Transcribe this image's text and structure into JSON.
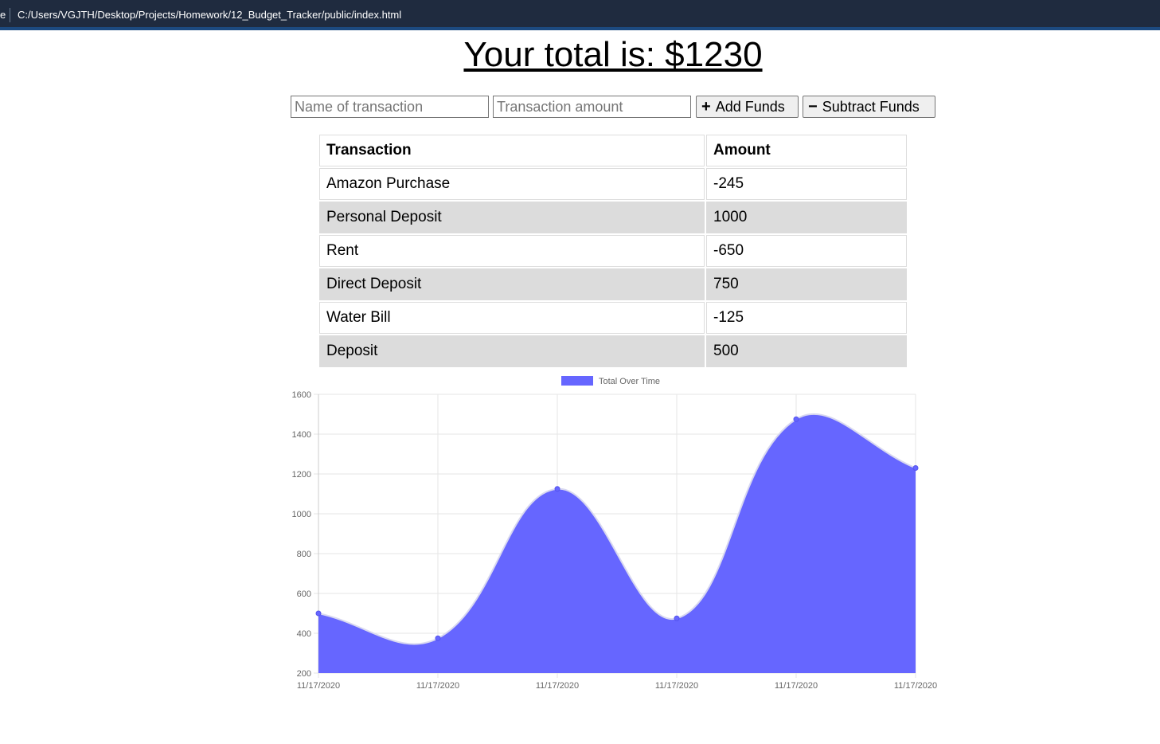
{
  "window": {
    "edge_text": "e",
    "path": "C:/Users/VGJTH/Desktop/Projects/Homework/12_Budget_Tracker/public/index.html"
  },
  "header": {
    "title": "Your total is: $1230"
  },
  "form": {
    "name_placeholder": "Name of transaction",
    "amount_placeholder": "Transaction amount",
    "add_label": "Add Funds",
    "subtract_label": "Subtract Funds",
    "add_icon": "+",
    "subtract_icon": "−"
  },
  "table": {
    "headers": [
      "Transaction",
      "Amount"
    ],
    "rows": [
      [
        "Amazon Purchase",
        "-245"
      ],
      [
        "Personal Deposit",
        "1000"
      ],
      [
        "Rent",
        "-650"
      ],
      [
        "Direct Deposit",
        "750"
      ],
      [
        "Water Bill",
        "-125"
      ],
      [
        "Deposit",
        "500"
      ]
    ]
  },
  "colors": {
    "fill": "#6666ff"
  },
  "chart_data": {
    "type": "area",
    "legend": "Total Over Time",
    "legend_position": "top",
    "x": [
      "11/17/2020",
      "11/17/2020",
      "11/17/2020",
      "11/17/2020",
      "11/17/2020",
      "11/17/2020"
    ],
    "values": [
      500,
      375,
      1125,
      475,
      1475,
      1230
    ],
    "ylim": [
      200,
      1600
    ],
    "yticks": [
      200,
      400,
      600,
      800,
      1000,
      1200,
      1400,
      1600
    ],
    "grid": true
  }
}
